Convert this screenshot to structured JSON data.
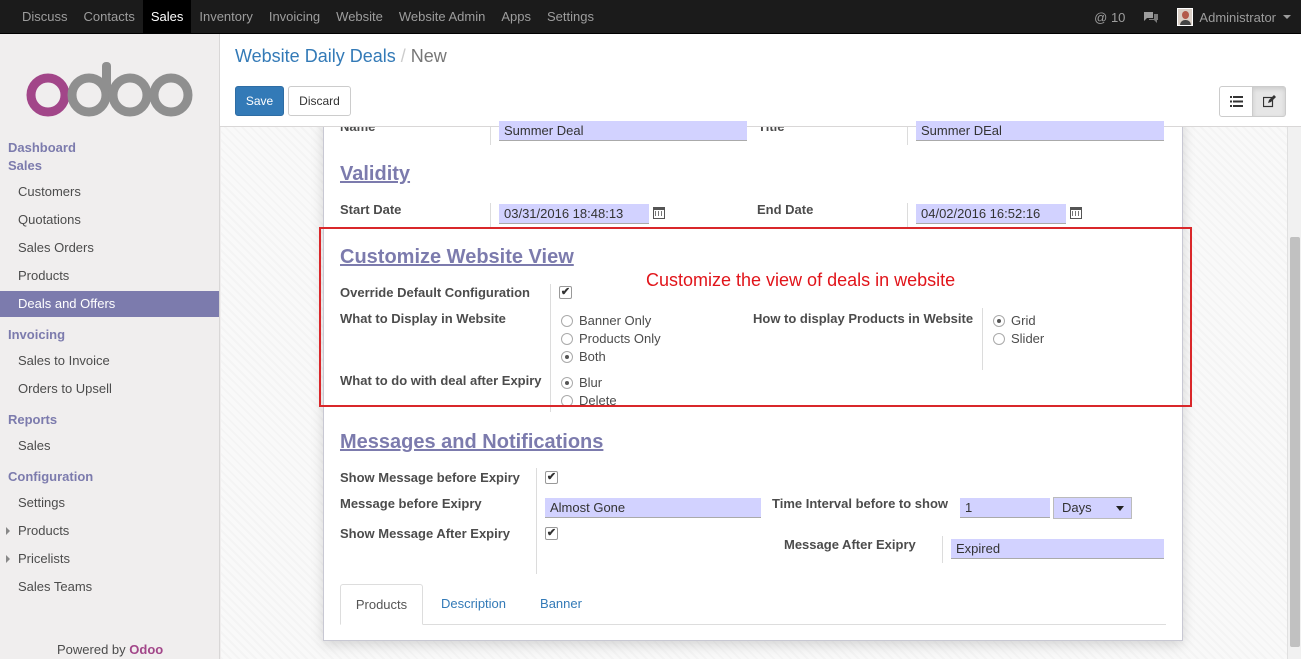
{
  "topbar": {
    "menu": [
      "Discuss",
      "Contacts",
      "Sales",
      "Inventory",
      "Invoicing",
      "Website",
      "Website Admin",
      "Apps",
      "Settings"
    ],
    "active": "Sales",
    "mentions": "@ 10",
    "user": "Administrator"
  },
  "sidebar": {
    "sections": {
      "dashboard": "Dashboard",
      "sales": "Sales",
      "invoicing": "Invoicing",
      "reports": "Reports",
      "configuration": "Configuration"
    },
    "items": {
      "customers": "Customers",
      "quotations": "Quotations",
      "sales_orders": "Sales Orders",
      "products": "Products",
      "deals": "Deals and Offers",
      "sales_to_invoice": "Sales to Invoice",
      "orders_to_upsell": "Orders to Upsell",
      "report_sales": "Sales",
      "settings": "Settings",
      "conf_products": "Products",
      "pricelists": "Pricelists",
      "sales_teams": "Sales Teams"
    },
    "powered_by": "Powered by",
    "powered_brand": "Odoo"
  },
  "control": {
    "breadcrumb_parent": "Website Daily Deals",
    "breadcrumb_sep": "/",
    "breadcrumb_current": "New",
    "save": "Save",
    "discard": "Discard"
  },
  "form": {
    "name_label": "Name",
    "name_value": "Summer Deal",
    "title_label": "Title",
    "title_value": "Summer DEal",
    "validity_title": "Validity",
    "start_date_label": "Start Date",
    "start_date_value": "03/31/2016 18:48:13",
    "end_date_label": "End Date",
    "end_date_value": "04/02/2016 16:52:16",
    "customize_title": "Customize Website View",
    "override_label": "Override Default Configuration",
    "override_checked": true,
    "display_label": "What to Display in Website",
    "display_options": [
      "Banner Only",
      "Products Only",
      "Both"
    ],
    "display_selected": "Both",
    "products_display_label": "How to display Products in Website",
    "products_display_options": [
      "Grid",
      "Slider"
    ],
    "products_display_selected": "Grid",
    "after_expiry_label": "What to do with deal after Expiry",
    "after_expiry_options": [
      "Blur",
      "Delete"
    ],
    "after_expiry_selected": "Blur",
    "messages_title": "Messages and Notifications",
    "show_before_label": "Show Message before Expiry",
    "show_before_checked": true,
    "msg_before_label": "Message before Exipry",
    "msg_before_value": "Almost Gone",
    "interval_label": "Time Interval before to show",
    "interval_value": "1",
    "interval_unit": "Days",
    "show_after_label": "Show Message After Expiry",
    "show_after_checked": true,
    "msg_after_label": "Message After Exipry",
    "msg_after_value": "Expired"
  },
  "tabs": [
    "Products",
    "Description",
    "Banner"
  ],
  "active_tab": "Products",
  "annotation": "Customize the view of deals in website",
  "colors": {
    "accent": "#7c7bad",
    "brand": "#a24689",
    "link": "#337ab7",
    "annotation": "#e1141a",
    "field_bg": "#d2d2ff"
  }
}
